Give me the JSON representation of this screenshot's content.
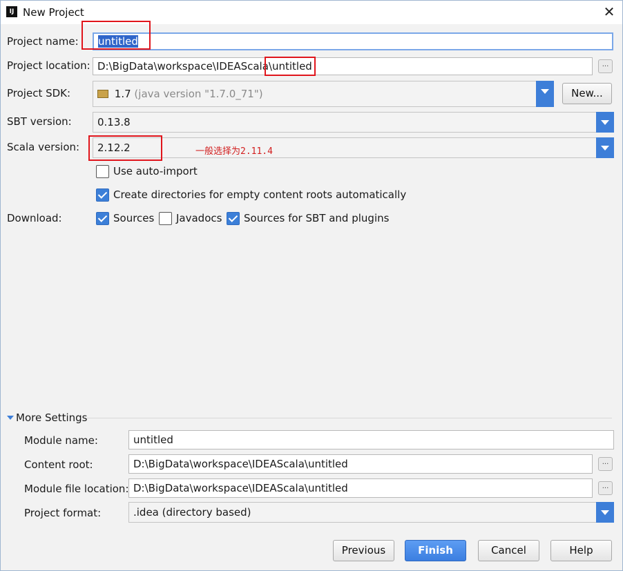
{
  "window": {
    "title": "New Project",
    "close_glyph": "✕",
    "app_icon": "IJ"
  },
  "form": {
    "project_name": {
      "label": "Project name:",
      "value": "untitled"
    },
    "project_location": {
      "label": "Project location:",
      "value_prefix": "D:\\BigData\\workspace\\IDEAScala\\",
      "value_suffix": "untitled",
      "browse": "..."
    },
    "project_sdk": {
      "label": "Project SDK:",
      "version": "1.7",
      "detail": "(java version \"1.7.0_71\")",
      "new_button": "New..."
    },
    "sbt_version": {
      "label": "SBT version:",
      "value": "0.13.8"
    },
    "scala_version": {
      "label": "Scala version:",
      "value": "2.12.2",
      "annotation": "一般选择为2.11.4"
    },
    "use_auto_import": {
      "label": "Use auto-import",
      "checked": false
    },
    "create_directories": {
      "label": "Create directories for empty content roots automatically",
      "checked": true
    },
    "download": {
      "label": "Download:",
      "sources": {
        "label": "Sources",
        "checked": true
      },
      "javadocs": {
        "label": "Javadocs",
        "checked": false
      },
      "sbt_sources": {
        "label": "Sources for SBT and plugins",
        "checked": true
      }
    }
  },
  "more_settings": {
    "title": "More Settings",
    "module_name": {
      "label": "Module name:",
      "value": "untitled"
    },
    "content_root": {
      "label": "Content root:",
      "value": "D:\\BigData\\workspace\\IDEAScala\\untitled",
      "browse": "..."
    },
    "module_file_location": {
      "label": "Module file location:",
      "value": "D:\\BigData\\workspace\\IDEAScala\\untitled",
      "browse": "..."
    },
    "project_format": {
      "label": "Project format:",
      "value": ".idea (directory based)"
    }
  },
  "buttons": {
    "previous": "Previous",
    "finish": "Finish",
    "cancel": "Cancel",
    "help": "Help"
  },
  "colors": {
    "accent": "#3d7ed8",
    "annotation_red": "#e0141b"
  }
}
